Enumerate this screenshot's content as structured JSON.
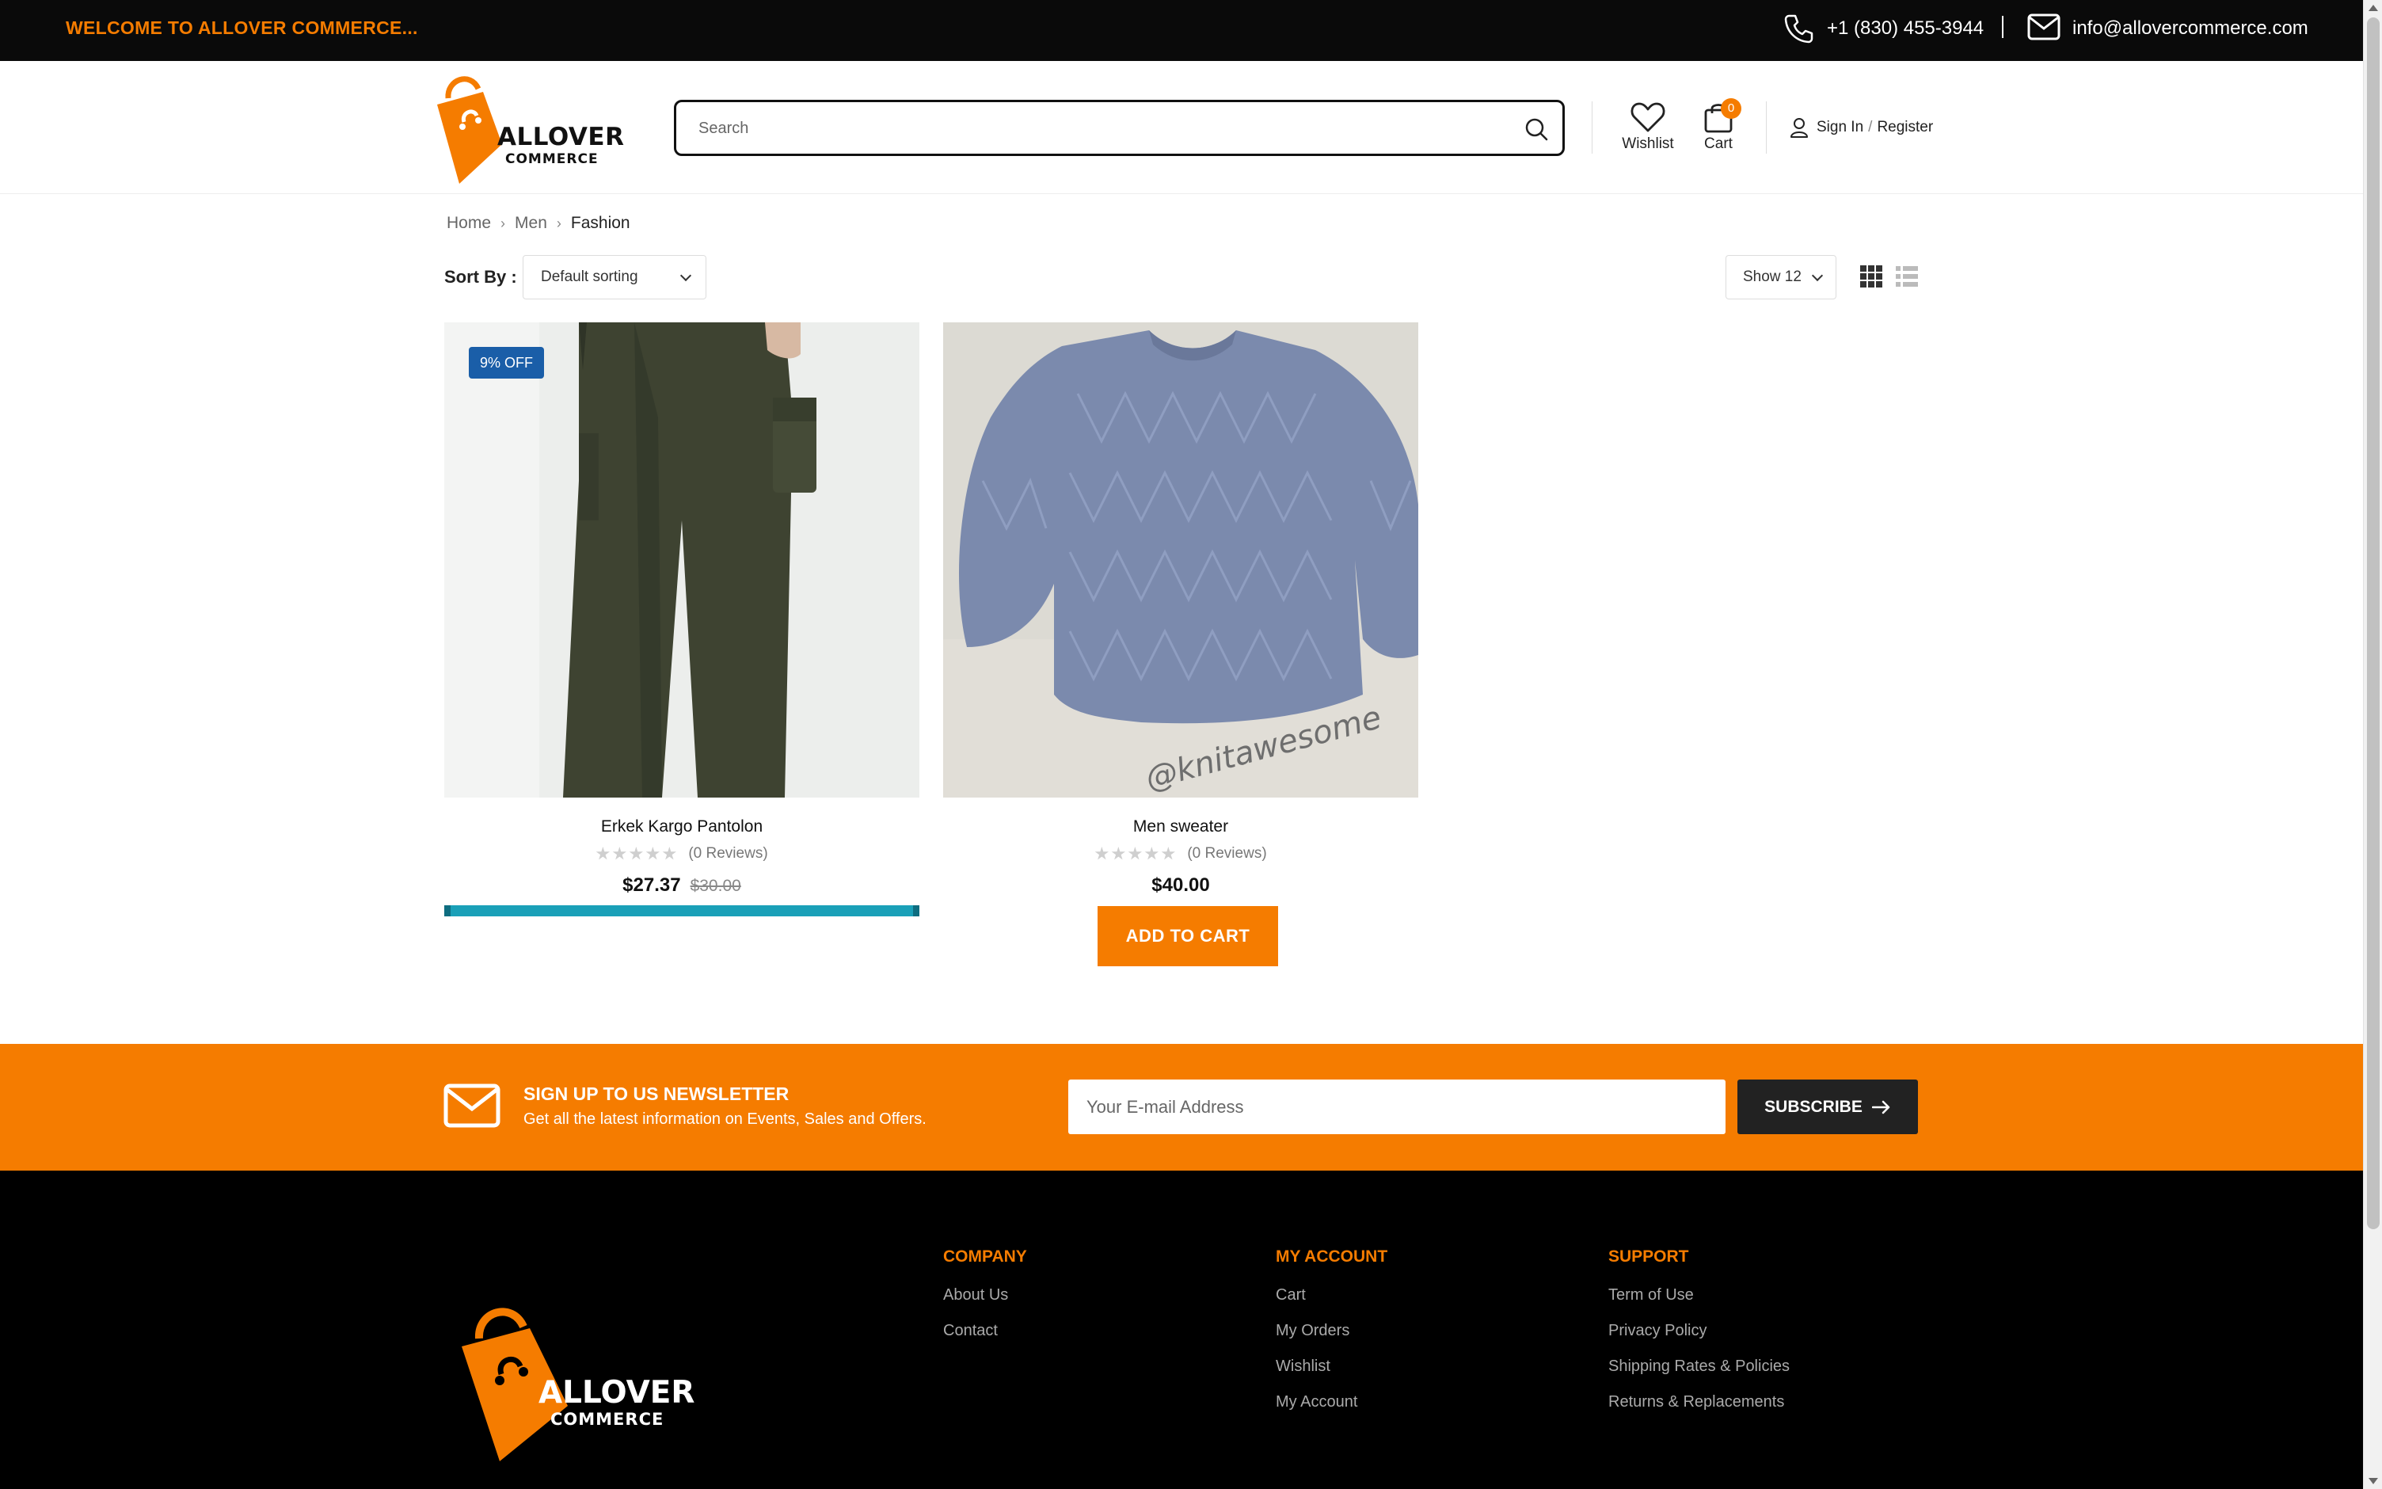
{
  "topbar": {
    "welcome": "WELCOME TO ALLOVER COMMERCE...",
    "phone": "+1 (830) 455-3944",
    "email": "info@allovercommerce.com",
    "icons": [
      "phone-icon",
      "mail-icon"
    ]
  },
  "header": {
    "logo_title": "ALLOVER",
    "logo_subtitle": "COMMERCE",
    "search_placeholder": "Search",
    "wishlist_label": "Wishlist",
    "cart_label": "Cart",
    "cart_count": "0",
    "sign_in": "Sign In",
    "slash": "/",
    "register": "Register"
  },
  "breadcrumb": {
    "items": [
      "Home",
      "Men",
      "Fashion"
    ]
  },
  "toolbar": {
    "sort_label": "Sort By :",
    "sort_value": "Default sorting",
    "show_value": "Show 12"
  },
  "products": [
    {
      "name": "Erkek Kargo Pantolon",
      "reviews": "(0 Reviews)",
      "price": "$27.37",
      "old_price": "$30.00",
      "badge": "9% OFF",
      "rating": 0
    },
    {
      "name": "Men sweater",
      "reviews": "(0 Reviews)",
      "price": "$40.00",
      "button": "ADD TO CART",
      "watermark": "@knitawesome",
      "rating": 0
    }
  ],
  "newsletter": {
    "title": "SIGN UP TO US NEWSLETTER",
    "subtitle": "Get all the latest information on Events, Sales and Offers.",
    "placeholder": "Your E-mail Address",
    "button": "SUBSCRIBE"
  },
  "footer": {
    "logo_title": "ALLOVER",
    "logo_subtitle": "COMMERCE",
    "columns": [
      {
        "title": "COMPANY",
        "links": [
          "About Us",
          "Contact"
        ]
      },
      {
        "title": "MY ACCOUNT",
        "links": [
          "Cart",
          "My Orders",
          "Wishlist",
          "My Account"
        ]
      },
      {
        "title": "SUPPORT",
        "links": [
          "Term of Use",
          "Privacy Policy",
          "Shipping Rates & Policies",
          "Returns & Replacements"
        ]
      }
    ]
  },
  "colors": {
    "brand_orange": "#f57c00",
    "topbar_bg": "#0a0a0a",
    "badge_blue": "#1a5ea8",
    "progress_teal": "#1aa0b8",
    "footer_bg": "#000000"
  }
}
